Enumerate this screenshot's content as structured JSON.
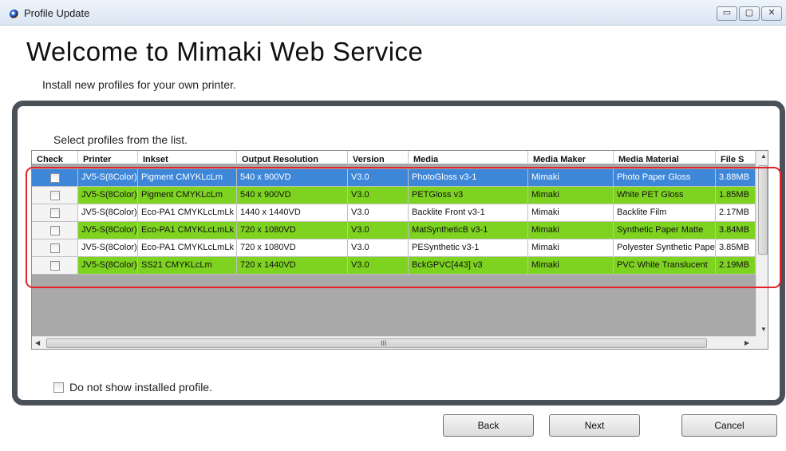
{
  "window": {
    "title": "Profile Update",
    "min_glyph": "▭",
    "max_glyph": "▢",
    "close_glyph": "✕"
  },
  "header": {
    "title": "Welcome to Mimaki Web Service",
    "subtitle": "Install new profiles for your own printer."
  },
  "panel": {
    "instruction": "Select profiles from the list."
  },
  "table": {
    "columns": [
      "Check",
      "Printer",
      "Inkset",
      "Output Resolution",
      "Version",
      "Media",
      "Media Maker",
      "Media Material",
      "File S"
    ],
    "rows": [
      {
        "checked": false,
        "selected": true,
        "color": "#3e87d8",
        "cells": [
          "JV5-S(8Color)",
          "Pigment CMYKLcLm",
          "540 x 900VD",
          "V3.0",
          "PhotoGloss v3-1",
          "Mimaki",
          "Photo Paper Gloss",
          "3.88MB"
        ]
      },
      {
        "checked": false,
        "selected": false,
        "color": "#7ed321",
        "cells": [
          "JV5-S(8Color)",
          "Pigment CMYKLcLm",
          "540 x 900VD",
          "V3.0",
          "PETGloss v3",
          "Mimaki",
          "White PET Gloss",
          "1.85MB"
        ]
      },
      {
        "checked": false,
        "selected": false,
        "color": "#ffffff",
        "cells": [
          "JV5-S(8Color)",
          "Eco-PA1 CMYKLcLmLk",
          "1440 x 1440VD",
          "V3.0",
          "Backlite Front v3-1",
          "Mimaki",
          "Backlite Film",
          "2.17MB"
        ]
      },
      {
        "checked": false,
        "selected": false,
        "color": "#7ed321",
        "cells": [
          "JV5-S(8Color)",
          "Eco-PA1 CMYKLcLmLk",
          "720 x 1080VD",
          "V3.0",
          "MatSyntheticB v3-1",
          "Mimaki",
          "Synthetic Paper Matte",
          "3.84MB"
        ]
      },
      {
        "checked": false,
        "selected": false,
        "color": "#ffffff",
        "cells": [
          "JV5-S(8Color)",
          "Eco-PA1 CMYKLcLmLk",
          "720 x 1080VD",
          "V3.0",
          "PESynthetic v3-1",
          "Mimaki",
          "Polyester Synthetic Paper",
          "3.85MB"
        ]
      },
      {
        "checked": false,
        "selected": false,
        "color": "#7ed321",
        "cells": [
          "JV5-S(8Color)",
          "SS21 CMYKLcLm",
          "720 x 1440VD",
          "V3.0",
          "BckGPVC[443] v3",
          "Mimaki",
          "PVC White Translucent",
          "2.19MB"
        ]
      }
    ],
    "hscroll_grip": "III",
    "arrow_up": "▲",
    "arrow_down": "▼",
    "arrow_left": "◀",
    "arrow_right": "▶"
  },
  "options": {
    "hide_installed_label": "Do not show installed profile.",
    "hide_installed_checked": false
  },
  "buttons": {
    "back": "Back",
    "next": "Next",
    "cancel": "Cancel"
  },
  "colors": {
    "accent_highlight": "#e0242a",
    "row_green": "#7ed321",
    "row_selected": "#3e87d8",
    "panel_border": "#4b5158"
  }
}
